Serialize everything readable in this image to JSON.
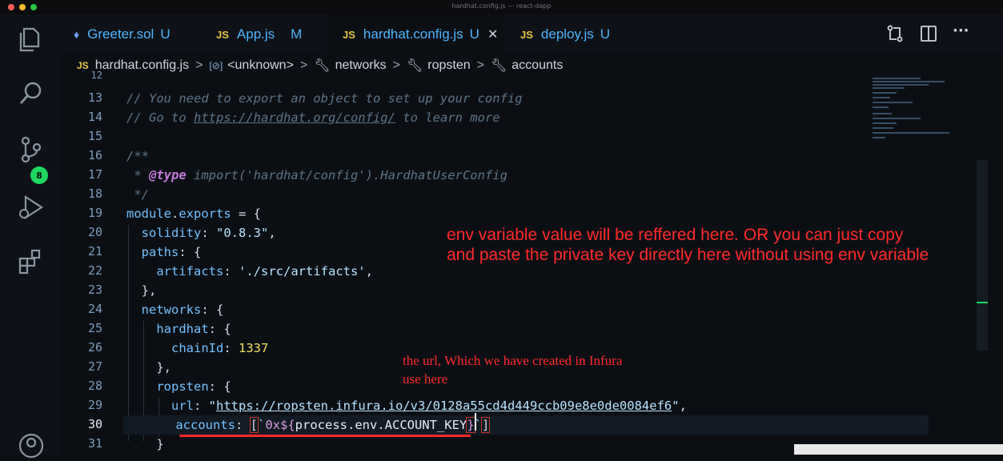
{
  "window": {
    "title": "hardhat.config.js — react-dapp"
  },
  "activity_bar": {
    "items": [
      {
        "name": "explorer-icon"
      },
      {
        "name": "search-icon"
      },
      {
        "name": "source-control-icon",
        "badge": "8"
      },
      {
        "name": "run-debug-icon"
      },
      {
        "name": "extensions-icon"
      },
      {
        "name": "account-icon"
      }
    ]
  },
  "tabs": [
    {
      "label": "Greeter.sol",
      "flag": "U",
      "icon": "solidity-gem-icon",
      "active": false
    },
    {
      "label": "App.js",
      "flag": "M",
      "icon_text": "JS",
      "active": false
    },
    {
      "label": "hardhat.config.js",
      "flag": "U",
      "icon_text": "JS",
      "active": true
    },
    {
      "label": "deploy.js",
      "flag": "U",
      "icon_text": "JS",
      "active": false
    }
  ],
  "toolbar": {
    "icons": [
      "compare-changes-icon",
      "split-editor-icon",
      "more-actions-icon"
    ],
    "more_label": "···"
  },
  "breadcrumb": {
    "file_icon": "JS",
    "items": [
      "hardhat.config.js",
      "<unknown>",
      "networks",
      "ropsten",
      "accounts"
    ],
    "separator": ">"
  },
  "editor": {
    "top_partial_line": "12",
    "line_numbers": [
      "13",
      "14",
      "15",
      "16",
      "17",
      "18",
      "19",
      "20",
      "21",
      "22",
      "23",
      "24",
      "25",
      "26",
      "27",
      "28",
      "29",
      "30",
      "31"
    ],
    "current_line": "30",
    "lines": {
      "l13": "// You need to export an object to set up your config",
      "l14_prefix": "// Go to ",
      "l14_link": "https://hardhat.org/config/",
      "l14_suffix": " to learn more",
      "l15": "",
      "l16": "/**",
      "l17_prefix": " * ",
      "l17_tag": "@type",
      "l17_suffix": " import('hardhat/config').HardhatUserConfig",
      "l18": " */",
      "l19_a": "module",
      "l19_b": ".",
      "l19_c": "exports",
      "l19_d": " = {",
      "l20_key": "solidity",
      "l20_colon": ": ",
      "l20_val": "\"0.8.3\"",
      "l20_end": ",",
      "l21_key": "paths",
      "l21_end": ": {",
      "l22_key": "artifacts",
      "l22_colon": ": ",
      "l22_val": "'./src/artifacts'",
      "l22_end": ",",
      "l23": "},",
      "l24_key": "networks",
      "l24_end": ": {",
      "l25_key": "hardhat",
      "l25_end": ": {",
      "l26_key": "chainId",
      "l26_colon": ": ",
      "l26_val": "1337",
      "l27": "},",
      "l28_key": "ropsten",
      "l28_end": ": {",
      "l29_key": "url",
      "l29_colon": ": ",
      "l29_q1": "\"",
      "l29_val": "https://ropsten.infura.io/v3/0128a55cd4d449ccb09e8e0de0084ef6",
      "l29_q2": "\"",
      "l29_end": ",",
      "l30_key": "accounts",
      "l30_colon": ": ",
      "l30_open": "[",
      "l30_tick": "`",
      "l30_tmpl": "0x${",
      "l30_var": "process.env.ACCOUNT_KEY",
      "l30_close_brace": "}",
      "l30_tick2": "`",
      "l30_close": "]",
      "l31": "}"
    }
  },
  "annotations": {
    "big_line1": "env variable value will be reffered here. OR you can just copy",
    "big_line2": "and paste the private key directly here without using env variable",
    "small_line1": "the url, Which we have created in Infura",
    "small_line2": "use here"
  },
  "colors": {
    "annotation": "#ff2a2a",
    "badge": "#1ed760",
    "tab_text": "#4fb6ff",
    "js_icon": "#e8c440"
  }
}
